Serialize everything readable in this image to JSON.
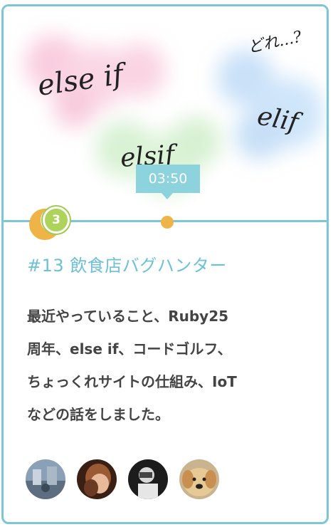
{
  "episode": {
    "time": "03:50",
    "comment_count": "3",
    "title": "#13 飲食店バグハンター",
    "description_lines": [
      "最近やっていること、Ruby25",
      "周年、else if、コードゴルフ、",
      "ちょっくれサイトの仕組み、IoT",
      "などの話をしました。"
    ]
  },
  "thumbnail": {
    "words": [
      "else if",
      "どれ...?",
      "elif",
      "elsif"
    ]
  },
  "colors": {
    "accent": "#7cc6d6",
    "title": "#6cc0d8",
    "badge_green": "#aed35b",
    "dot_orange": "#eeb447"
  },
  "avatars": [
    {
      "name": "avatar-1"
    },
    {
      "name": "avatar-2"
    },
    {
      "name": "avatar-3"
    },
    {
      "name": "avatar-dog"
    }
  ]
}
